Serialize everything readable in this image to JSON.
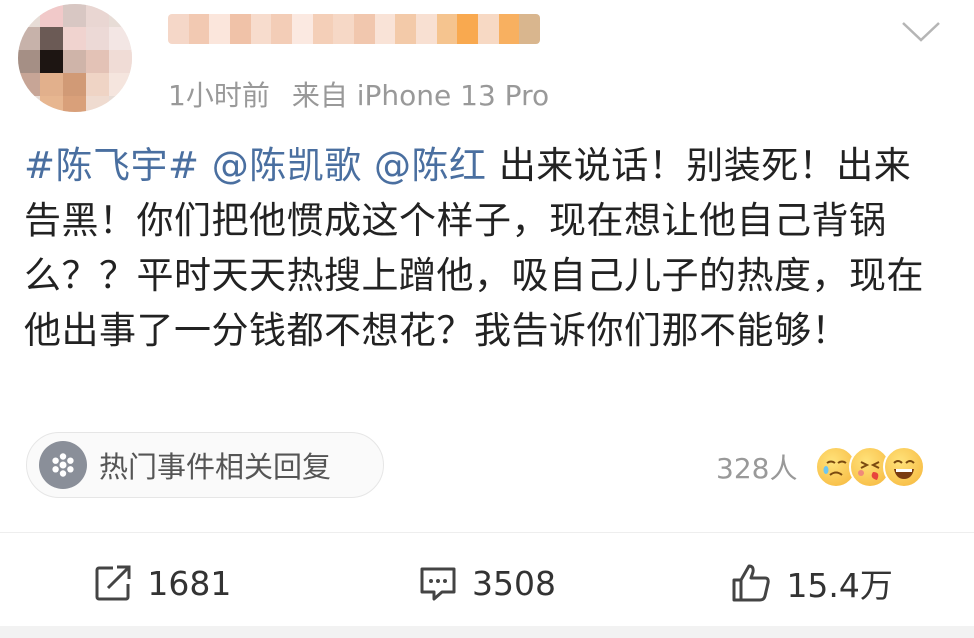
{
  "post": {
    "meta": {
      "time": "1小时前",
      "source": "来自 iPhone 13 Pro"
    },
    "content": {
      "hashtag": "#陈飞宇#",
      "mention_1": "@陈凯歌",
      "mention_2": "@陈红",
      "text": "出来说话！别装死！出来告黑！你们把他惯成这个样子，现在想让他自己背锅么？？平时天天热搜上蹭他，吸自己儿子的热度，现在他出事了一分钱都不想花？我告诉你们那不能够！"
    },
    "hot_reply": {
      "label": "热门事件相关回复"
    },
    "reactions": {
      "count": "328人",
      "emojis": [
        "crying-emoji",
        "kiss-emoji",
        "laughing-emoji"
      ]
    },
    "actions": {
      "share_count": "1681",
      "comment_count": "3508",
      "like_count": "15.4万"
    }
  },
  "colors": {
    "link": "#4a6fa0",
    "meta": "#999999",
    "text": "#222222"
  }
}
